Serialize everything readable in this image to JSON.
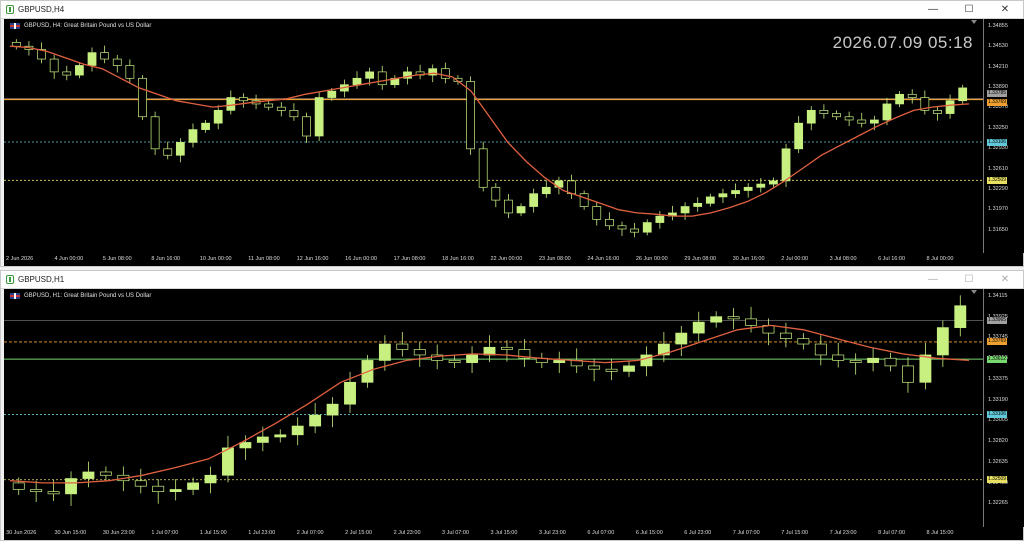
{
  "top_window": {
    "title": "GBPUSD,H4",
    "chart_title": "GBPUSD, H4:  Great Britain Pound vs US Dollar",
    "server_time": "2026.07.09 05:18",
    "y_ticks": [
      "1.34855",
      "1.34530",
      "1.34210",
      "1.33890",
      "1.33570",
      "1.33250",
      "1.32930",
      "1.32610",
      "1.32290",
      "1.31970",
      "1.31650"
    ],
    "price_tags": [
      {
        "label": "1.33785",
        "color": "#a0a0a0",
        "text": "#000"
      },
      {
        "label": "1.33769",
        "color": "#f0a030",
        "text": "#000"
      },
      {
        "label": "1.33106",
        "color": "#60c8d8",
        "text": "#000"
      },
      {
        "label": "1.32509",
        "color": "#e8e060",
        "text": "#000"
      }
    ],
    "x_ticks": [
      "2 Jun 2026",
      "4 Jun 00:00",
      "5 Jun 08:00",
      "8 Jun 16:00",
      "10 Jun 00:00",
      "11 Jun 08:00",
      "12 Jun 16:00",
      "16 Jun 00:00",
      "17 Jun 08:00",
      "18 Jun 16:00",
      "22 Jun 00:00",
      "23 Jun 08:00",
      "24 Jun 16:00",
      "26 Jun 00:00",
      "29 Jun 08:00",
      "30 Jun 16:00",
      "2 Jul 00:00",
      "3 Jul 08:00",
      "6 Jul 16:00",
      "8 Jul 00:00"
    ]
  },
  "bottom_window": {
    "title": "GBPUSD,H1",
    "chart_title": "GBPUSD, H1:  Great Britain Pound vs US Dollar",
    "y_ticks": [
      "1.34115",
      "1.33925",
      "1.33745",
      "1.33555",
      "1.33375",
      "1.33190",
      "1.33005",
      "1.32820",
      "1.32635",
      "1.32450",
      "1.32265"
    ],
    "price_tags": [
      {
        "label": "1.33965",
        "color": "#a0a0a0",
        "text": "#000"
      },
      {
        "label": "1.33769",
        "color": "#f0a030",
        "text": "#000"
      },
      {
        "label": "1.33612",
        "color": "#78d870",
        "text": "#000"
      },
      {
        "label": "1.33106",
        "color": "#60c8d8",
        "text": "#000"
      },
      {
        "label": "1.32509",
        "color": "#e8e060",
        "text": "#000"
      }
    ],
    "x_ticks": [
      "30 Jun 2026",
      "30 Jun 15:00",
      "30 Jun 23:00",
      "1 Jul 07:00",
      "1 Jul 15:00",
      "1 Jul 23:00",
      "2 Jul 07:00",
      "2 Jul 15:00",
      "2 Jul 23:00",
      "3 Jul 07:00",
      "3 Jul 15:00",
      "3 Jul 23:00",
      "6 Jul 07:00",
      "6 Jul 15:00",
      "6 Jul 23:00",
      "7 Jul 07:00",
      "7 Jul 15:00",
      "7 Jul 23:00",
      "8 Jul 07:00",
      "8 Jul 15:00"
    ]
  },
  "colors": {
    "bull": "#c8f080",
    "bear": "#c8f080",
    "ma": "#e06040",
    "bg": "#000000",
    "grid_orange": "#f0a030",
    "grid_cyan": "#60c8d8",
    "grid_yellow": "#e8e060",
    "grid_gray": "#a0a0a0",
    "grid_green": "#78d870"
  },
  "chart_data": [
    {
      "type": "candlestick",
      "symbol": "GBPUSD",
      "timeframe": "H4",
      "ylim": [
        1.315,
        1.349
      ],
      "close_series": [
        1.346,
        1.3455,
        1.344,
        1.342,
        1.3415,
        1.343,
        1.345,
        1.344,
        1.343,
        1.341,
        1.335,
        1.33,
        1.329,
        1.331,
        1.333,
        1.334,
        1.336,
        1.338,
        1.3375,
        1.337,
        1.3365,
        1.336,
        1.335,
        1.332,
        1.338,
        1.339,
        1.34,
        1.341,
        1.342,
        1.34,
        1.341,
        1.342,
        1.3415,
        1.3425,
        1.341,
        1.3405,
        1.33,
        1.324,
        1.322,
        1.32,
        1.321,
        1.323,
        1.324,
        1.325,
        1.323,
        1.321,
        1.319,
        1.318,
        1.3175,
        1.317,
        1.3185,
        1.3195,
        1.32,
        1.321,
        1.3215,
        1.3225,
        1.323,
        1.3235,
        1.324,
        1.3245,
        1.325,
        1.33,
        1.334,
        1.336,
        1.3355,
        1.335,
        1.3345,
        1.334,
        1.3345,
        1.337,
        1.3385,
        1.338,
        1.336,
        1.3355,
        1.3375,
        1.3395
      ],
      "ma_series": [
        1.346,
        1.3458,
        1.3452,
        1.3442,
        1.3432,
        1.3425,
        1.341,
        1.3395,
        1.3385,
        1.3375,
        1.337,
        1.3365,
        1.3368,
        1.3372,
        1.3375,
        1.3378,
        1.3385,
        1.339,
        1.3395,
        1.34,
        1.3405,
        1.341,
        1.3415,
        1.3418,
        1.3412,
        1.339,
        1.335,
        1.331,
        1.328,
        1.3255,
        1.3235,
        1.3225,
        1.3215,
        1.3205,
        1.32,
        1.3198,
        1.3195,
        1.3195,
        1.32,
        1.3208,
        1.3218,
        1.3232,
        1.325,
        1.327,
        1.329,
        1.3305,
        1.332,
        1.3335,
        1.3348,
        1.336,
        1.3365,
        1.3368,
        1.337
      ]
    },
    {
      "type": "candlestick",
      "symbol": "GBPUSD",
      "timeframe": "H1",
      "ylim": [
        1.3215,
        1.3418
      ],
      "close_series": [
        1.3242,
        1.324,
        1.3238,
        1.3252,
        1.3258,
        1.3255,
        1.325,
        1.3245,
        1.324,
        1.3242,
        1.3248,
        1.3255,
        1.328,
        1.3285,
        1.329,
        1.3292,
        1.33,
        1.331,
        1.332,
        1.334,
        1.336,
        1.3375,
        1.337,
        1.3365,
        1.336,
        1.3358,
        1.3365,
        1.3372,
        1.337,
        1.3362,
        1.3358,
        1.336,
        1.3355,
        1.3352,
        1.335,
        1.3355,
        1.3365,
        1.3375,
        1.3385,
        1.3395,
        1.34,
        1.3398,
        1.3392,
        1.3385,
        1.338,
        1.3375,
        1.3365,
        1.336,
        1.3358,
        1.3362,
        1.3355,
        1.334,
        1.3365,
        1.339,
        1.341
      ],
      "ma_series": [
        1.325,
        1.3248,
        1.3248,
        1.325,
        1.3255,
        1.3262,
        1.327,
        1.3285,
        1.3302,
        1.332,
        1.334,
        1.3352,
        1.336,
        1.3364,
        1.3366,
        1.3365,
        1.3362,
        1.336,
        1.3358,
        1.336,
        1.3368,
        1.3378,
        1.3388,
        1.3392,
        1.3388,
        1.338,
        1.3372,
        1.3366,
        1.3362,
        1.336
      ]
    }
  ]
}
